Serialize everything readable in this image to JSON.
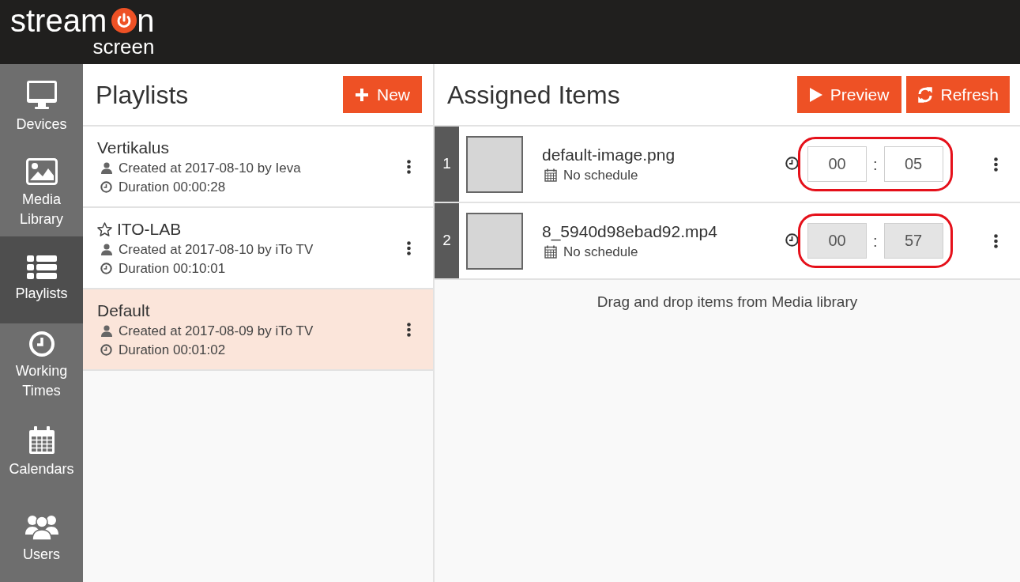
{
  "logo": {
    "first": "stream",
    "last": "n",
    "sub": "screen"
  },
  "sidebar": {
    "items": [
      {
        "kind": "monitor",
        "label": "Devices",
        "selected": false
      },
      {
        "kind": "image",
        "label": "Media Library",
        "selected": false
      },
      {
        "kind": "list",
        "label": "Playlists",
        "selected": true
      },
      {
        "kind": "clock",
        "label": "Working Times",
        "selected": false
      },
      {
        "kind": "calendar",
        "label": "Calendars",
        "selected": false
      },
      {
        "kind": "users",
        "label": "Users",
        "selected": false
      }
    ]
  },
  "playlists": {
    "title": "Playlists",
    "new_button": "New",
    "items": [
      {
        "name": "Vertikalus",
        "favorite": false,
        "created": "Created at 2017-08-10 by Ieva",
        "duration": "Duration 00:00:28",
        "selected": false
      },
      {
        "name": "ITO-LAB",
        "favorite": true,
        "created": "Created at 2017-08-10 by iTo TV",
        "duration": "Duration 00:10:01",
        "selected": false
      },
      {
        "name": "Default",
        "favorite": false,
        "created": "Created at 2017-08-09 by iTo TV",
        "duration": "Duration 00:01:02",
        "selected": true
      }
    ]
  },
  "assigned": {
    "title": "Assigned Items",
    "preview_button": "Preview",
    "refresh_button": "Refresh",
    "items": [
      {
        "number": "1",
        "file": "default-image.png",
        "schedule": "No schedule",
        "minutes": "00",
        "separator": ":",
        "seconds": "05",
        "disabled": false,
        "highlighted": true
      },
      {
        "number": "2",
        "file": "8_5940d98ebad92.mp4",
        "schedule": "No schedule",
        "minutes": "00",
        "separator": ":",
        "seconds": "57",
        "disabled": true,
        "highlighted": true
      }
    ],
    "drop_hint": "Drag and drop items from Media library"
  }
}
